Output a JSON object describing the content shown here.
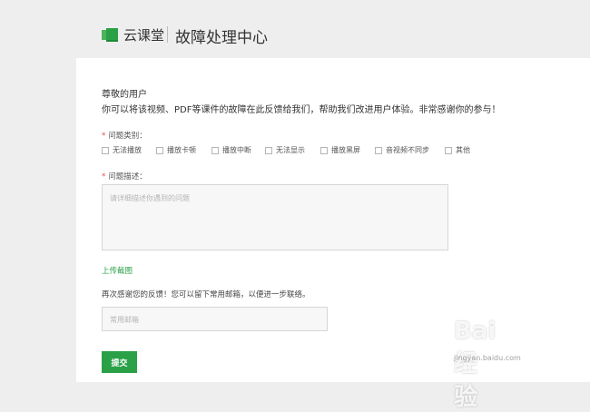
{
  "header": {
    "logo_text": "云课堂",
    "page_title": "故障处理中心"
  },
  "form": {
    "greeting": "尊敬的用户",
    "intro": "你可以将该视频、PDF等课件的故障在此反馈给我们，帮助我们改进用户体验。非常感谢你的参与！",
    "category_label": "问题类别：",
    "categories": [
      "无法播放",
      "播放卡顿",
      "播放中断",
      "无法显示",
      "播放黑屏",
      "音视频不同步",
      "其他"
    ],
    "description_label": "问题描述：",
    "description_placeholder": "请详细描述你遇到的问题",
    "upload_link": "上传截图",
    "thanks_text": "再次感谢您的反馈！您可以留下常用邮箱，以便进一步联络。",
    "email_placeholder": "常用邮箱",
    "submit_label": "提交"
  },
  "watermark": {
    "text": "Bai 经验",
    "url": "jingyan.baidu.com"
  },
  "colors": {
    "accent": "#2aa147",
    "background": "#eeeeee",
    "card": "#ffffff"
  }
}
